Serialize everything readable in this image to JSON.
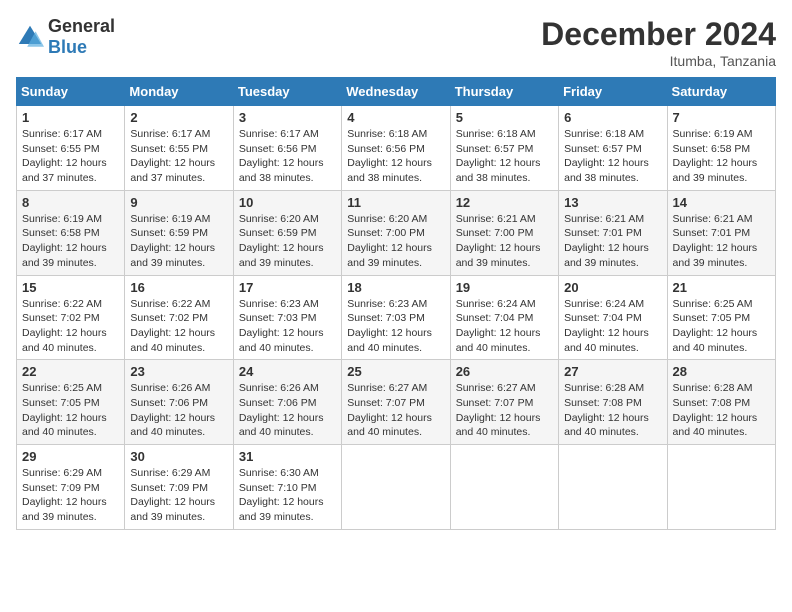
{
  "header": {
    "logo": {
      "general": "General",
      "blue": "Blue"
    },
    "title": "December 2024",
    "location": "Itumba, Tanzania"
  },
  "calendar": {
    "days_of_week": [
      "Sunday",
      "Monday",
      "Tuesday",
      "Wednesday",
      "Thursday",
      "Friday",
      "Saturday"
    ],
    "weeks": [
      [
        null,
        {
          "day": "2",
          "sunrise": "6:17 AM",
          "sunset": "6:55 PM",
          "daylight": "12 hours and 37 minutes."
        },
        {
          "day": "3",
          "sunrise": "6:17 AM",
          "sunset": "6:56 PM",
          "daylight": "12 hours and 38 minutes."
        },
        {
          "day": "4",
          "sunrise": "6:18 AM",
          "sunset": "6:56 PM",
          "daylight": "12 hours and 38 minutes."
        },
        {
          "day": "5",
          "sunrise": "6:18 AM",
          "sunset": "6:57 PM",
          "daylight": "12 hours and 38 minutes."
        },
        {
          "day": "6",
          "sunrise": "6:18 AM",
          "sunset": "6:57 PM",
          "daylight": "12 hours and 38 minutes."
        },
        {
          "day": "7",
          "sunrise": "6:19 AM",
          "sunset": "6:58 PM",
          "daylight": "12 hours and 39 minutes."
        }
      ],
      [
        {
          "day": "8",
          "sunrise": "6:19 AM",
          "sunset": "6:58 PM",
          "daylight": "12 hours and 39 minutes."
        },
        {
          "day": "9",
          "sunrise": "6:19 AM",
          "sunset": "6:59 PM",
          "daylight": "12 hours and 39 minutes."
        },
        {
          "day": "10",
          "sunrise": "6:20 AM",
          "sunset": "6:59 PM",
          "daylight": "12 hours and 39 minutes."
        },
        {
          "day": "11",
          "sunrise": "6:20 AM",
          "sunset": "7:00 PM",
          "daylight": "12 hours and 39 minutes."
        },
        {
          "day": "12",
          "sunrise": "6:21 AM",
          "sunset": "7:00 PM",
          "daylight": "12 hours and 39 minutes."
        },
        {
          "day": "13",
          "sunrise": "6:21 AM",
          "sunset": "7:01 PM",
          "daylight": "12 hours and 39 minutes."
        },
        {
          "day": "14",
          "sunrise": "6:21 AM",
          "sunset": "7:01 PM",
          "daylight": "12 hours and 39 minutes."
        }
      ],
      [
        {
          "day": "15",
          "sunrise": "6:22 AM",
          "sunset": "7:02 PM",
          "daylight": "12 hours and 40 minutes."
        },
        {
          "day": "16",
          "sunrise": "6:22 AM",
          "sunset": "7:02 PM",
          "daylight": "12 hours and 40 minutes."
        },
        {
          "day": "17",
          "sunrise": "6:23 AM",
          "sunset": "7:03 PM",
          "daylight": "12 hours and 40 minutes."
        },
        {
          "day": "18",
          "sunrise": "6:23 AM",
          "sunset": "7:03 PM",
          "daylight": "12 hours and 40 minutes."
        },
        {
          "day": "19",
          "sunrise": "6:24 AM",
          "sunset": "7:04 PM",
          "daylight": "12 hours and 40 minutes."
        },
        {
          "day": "20",
          "sunrise": "6:24 AM",
          "sunset": "7:04 PM",
          "daylight": "12 hours and 40 minutes."
        },
        {
          "day": "21",
          "sunrise": "6:25 AM",
          "sunset": "7:05 PM",
          "daylight": "12 hours and 40 minutes."
        }
      ],
      [
        {
          "day": "22",
          "sunrise": "6:25 AM",
          "sunset": "7:05 PM",
          "daylight": "12 hours and 40 minutes."
        },
        {
          "day": "23",
          "sunrise": "6:26 AM",
          "sunset": "7:06 PM",
          "daylight": "12 hours and 40 minutes."
        },
        {
          "day": "24",
          "sunrise": "6:26 AM",
          "sunset": "7:06 PM",
          "daylight": "12 hours and 40 minutes."
        },
        {
          "day": "25",
          "sunrise": "6:27 AM",
          "sunset": "7:07 PM",
          "daylight": "12 hours and 40 minutes."
        },
        {
          "day": "26",
          "sunrise": "6:27 AM",
          "sunset": "7:07 PM",
          "daylight": "12 hours and 40 minutes."
        },
        {
          "day": "27",
          "sunrise": "6:28 AM",
          "sunset": "7:08 PM",
          "daylight": "12 hours and 40 minutes."
        },
        {
          "day": "28",
          "sunrise": "6:28 AM",
          "sunset": "7:08 PM",
          "daylight": "12 hours and 40 minutes."
        }
      ],
      [
        {
          "day": "29",
          "sunrise": "6:29 AM",
          "sunset": "7:09 PM",
          "daylight": "12 hours and 39 minutes."
        },
        {
          "day": "30",
          "sunrise": "6:29 AM",
          "sunset": "7:09 PM",
          "daylight": "12 hours and 39 minutes."
        },
        {
          "day": "31",
          "sunrise": "6:30 AM",
          "sunset": "7:10 PM",
          "daylight": "12 hours and 39 minutes."
        },
        null,
        null,
        null,
        null
      ]
    ],
    "first_day": {
      "day": "1",
      "sunrise": "6:17 AM",
      "sunset": "6:55 PM",
      "daylight": "12 hours and 37 minutes."
    }
  }
}
